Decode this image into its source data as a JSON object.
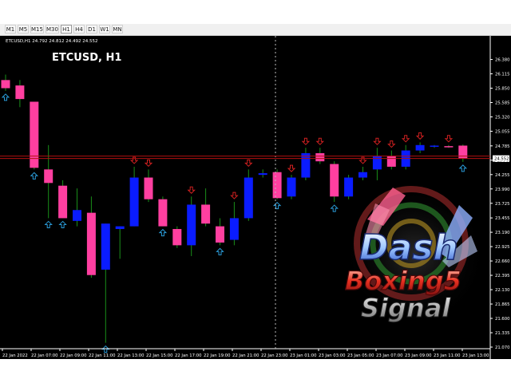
{
  "timeframes": [
    "M1",
    "M5",
    "M15",
    "M30",
    "H1",
    "H4",
    "D1",
    "W1",
    "MN"
  ],
  "active_timeframe": "H1",
  "chart_header": "ETCUSD,H1  24.792 24.812 24.492 24.552",
  "chart_title": "ETCUSD, H1",
  "current_price_label": "24.552",
  "colors": {
    "background": "#000000",
    "bull": "#0a1cff",
    "bear": "#ff3fa0",
    "wick": "#1a8f1a",
    "up_arrow": "#2a9bd8",
    "down_arrow": "#d02020",
    "price_line": "#b01010"
  },
  "watermark": {
    "line1": "Dash",
    "line2": "Boxing5",
    "line3": "Signal"
  },
  "chart_data": {
    "type": "candlestick",
    "title": "ETCUSD, H1",
    "symbol": "ETCUSD",
    "timeframe": "H1",
    "ylim": [
      21.07,
      26.55
    ],
    "price_ticks": [
      "26.380",
      "26.115",
      "25.850",
      "25.585",
      "25.320",
      "25.055",
      "24.785",
      "24.520",
      "24.255",
      "23.990",
      "23.725",
      "23.455",
      "23.190",
      "22.925",
      "22.660",
      "22.395",
      "22.130",
      "21.865",
      "21.600",
      "21.335",
      "21.070"
    ],
    "time_labels": [
      "22 Jan 2022",
      "22 Jan 07:00",
      "22 Jan 09:00",
      "22 Jan 11:00",
      "22 Jan 13:00",
      "22 Jan 15:00",
      "22 Jan 17:00",
      "22 Jan 19:00",
      "22 Jan 21:00",
      "22 Jan 23:00",
      "23 Jan 01:00",
      "23 Jan 03:00",
      "23 Jan 05:00",
      "23 Jan 07:00",
      "23 Jan 09:00",
      "23 Jan 11:00",
      "23 Jan 13:00"
    ],
    "last_price": 24.552,
    "candles": [
      {
        "o": 26.0,
        "h": 26.1,
        "l": 25.8,
        "c": 25.85
      },
      {
        "o": 25.9,
        "h": 26.0,
        "l": 25.5,
        "c": 25.65
      },
      {
        "o": 25.6,
        "h": 25.6,
        "l": 24.35,
        "c": 24.38
      },
      {
        "o": 24.35,
        "h": 24.8,
        "l": 23.45,
        "c": 24.1
      },
      {
        "o": 24.05,
        "h": 24.15,
        "l": 23.45,
        "c": 23.45
      },
      {
        "o": 23.4,
        "h": 24.0,
        "l": 23.3,
        "c": 23.6
      },
      {
        "o": 23.55,
        "h": 23.85,
        "l": 22.35,
        "c": 22.4
      },
      {
        "o": 22.5,
        "h": 23.35,
        "l": 21.15,
        "c": 23.35
      },
      {
        "o": 23.25,
        "h": 23.3,
        "l": 22.7,
        "c": 23.3
      },
      {
        "o": 23.3,
        "h": 24.4,
        "l": 23.3,
        "c": 24.2
      },
      {
        "o": 24.2,
        "h": 24.35,
        "l": 23.75,
        "c": 23.8
      },
      {
        "o": 23.8,
        "h": 23.85,
        "l": 23.3,
        "c": 23.3
      },
      {
        "o": 23.25,
        "h": 23.3,
        "l": 22.9,
        "c": 22.95
      },
      {
        "o": 22.95,
        "h": 23.85,
        "l": 22.75,
        "c": 23.7
      },
      {
        "o": 23.7,
        "h": 24.0,
        "l": 23.3,
        "c": 23.35
      },
      {
        "o": 23.3,
        "h": 23.45,
        "l": 22.95,
        "c": 23.0
      },
      {
        "o": 23.05,
        "h": 23.75,
        "l": 22.95,
        "c": 23.45
      },
      {
        "o": 23.45,
        "h": 24.35,
        "l": 23.4,
        "c": 24.2
      },
      {
        "o": 24.25,
        "h": 24.35,
        "l": 24.2,
        "c": 24.28
      },
      {
        "o": 24.3,
        "h": 24.35,
        "l": 23.8,
        "c": 23.82
      },
      {
        "o": 23.85,
        "h": 24.25,
        "l": 23.8,
        "c": 24.2
      },
      {
        "o": 24.2,
        "h": 24.75,
        "l": 24.15,
        "c": 24.65
      },
      {
        "o": 24.65,
        "h": 24.75,
        "l": 24.45,
        "c": 24.5
      },
      {
        "o": 24.45,
        "h": 24.5,
        "l": 23.75,
        "c": 23.85
      },
      {
        "o": 23.85,
        "h": 24.25,
        "l": 23.8,
        "c": 24.2
      },
      {
        "o": 24.2,
        "h": 24.4,
        "l": 24.15,
        "c": 24.3
      },
      {
        "o": 24.35,
        "h": 24.75,
        "l": 24.15,
        "c": 24.6
      },
      {
        "o": 24.6,
        "h": 24.7,
        "l": 24.35,
        "c": 24.4
      },
      {
        "o": 24.4,
        "h": 24.8,
        "l": 24.35,
        "c": 24.7
      },
      {
        "o": 24.7,
        "h": 24.85,
        "l": 24.65,
        "c": 24.8
      },
      {
        "o": 24.78,
        "h": 24.8,
        "l": 24.75,
        "c": 24.79
      },
      {
        "o": 24.78,
        "h": 24.8,
        "l": 24.75,
        "c": 24.77
      },
      {
        "o": 24.79,
        "h": 24.81,
        "l": 24.49,
        "c": 24.55
      }
    ],
    "signals_up": [
      0,
      2,
      3,
      4,
      7,
      11,
      15,
      19,
      23,
      32
    ],
    "signals_down": [
      9,
      10,
      13,
      16,
      17,
      20,
      21,
      22,
      25,
      26,
      27,
      28,
      29,
      31
    ]
  }
}
